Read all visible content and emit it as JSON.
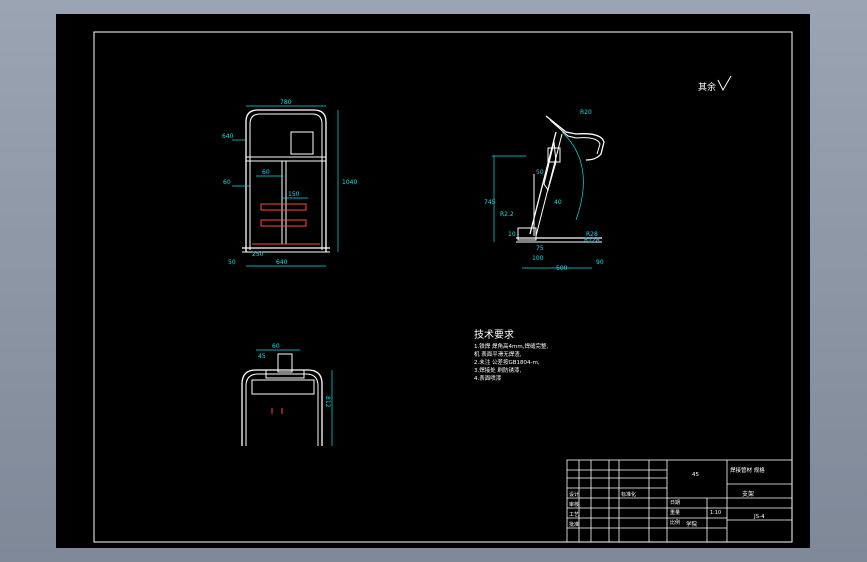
{
  "drawing": {
    "roughness_note": "其余",
    "tech_req": {
      "title": "技术要求",
      "lines": [
        "1.铁焊 焊角高4mm,焊缝完整,",
        "机 表面平滑无焊渣,",
        "2.未注 公差按GB1804-m,",
        "3.焊接处 刷防锈漆,",
        "4.表面喷漆"
      ]
    },
    "dims": {
      "front": [
        "780",
        "640",
        "60",
        "60",
        "150",
        "1040",
        "250",
        "640",
        "50"
      ],
      "side": [
        "R20",
        "R128",
        "R28",
        "40",
        "R2.2",
        "50",
        "10",
        "100",
        "500",
        "745",
        "90",
        "75"
      ],
      "top": [
        "60",
        "45",
        "812"
      ]
    },
    "title_block": {
      "center_label": "45",
      "material": "焊接管材 规格",
      "part_name": "支架",
      "scale": "1:10",
      "drawing_no": "JS-4",
      "company": "学院",
      "row_labels": [
        "设计",
        "审核",
        "工艺",
        "批准"
      ],
      "mid_labels": [
        "标准化",
        "日期",
        "重量",
        "比例"
      ]
    }
  }
}
